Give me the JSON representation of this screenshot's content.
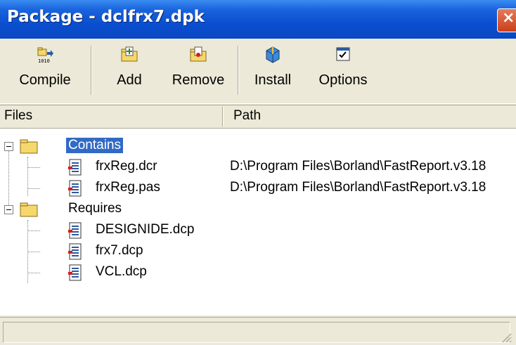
{
  "window": {
    "title": "Package - dclfrx7.dpk",
    "close_glyph": "×"
  },
  "toolbar": {
    "buttons": [
      {
        "label": "Compile",
        "icon": "compile-icon"
      },
      {
        "label": "Add",
        "icon": "add-icon"
      },
      {
        "label": "Remove",
        "icon": "remove-icon"
      },
      {
        "label": "Install",
        "icon": "install-icon"
      },
      {
        "label": "Options",
        "icon": "options-icon"
      }
    ]
  },
  "columns": {
    "files": "Files",
    "path": "Path"
  },
  "tree": {
    "contains": {
      "label": "Contains",
      "selected": true,
      "items": [
        {
          "name": "frxReg.dcr",
          "path": "D:\\Program Files\\Borland\\FastReport.v3.18"
        },
        {
          "name": "frxReg.pas",
          "path": "D:\\Program Files\\Borland\\FastReport.v3.18"
        }
      ]
    },
    "requires": {
      "label": "Requires",
      "items": [
        {
          "name": "DESIGNIDE.dcp"
        },
        {
          "name": "frx7.dcp"
        },
        {
          "name": "VCL.dcp"
        }
      ]
    }
  },
  "colors": {
    "titlebar": "#0a4fd0",
    "selection": "#316AC5",
    "face": "#ECE9D8"
  }
}
